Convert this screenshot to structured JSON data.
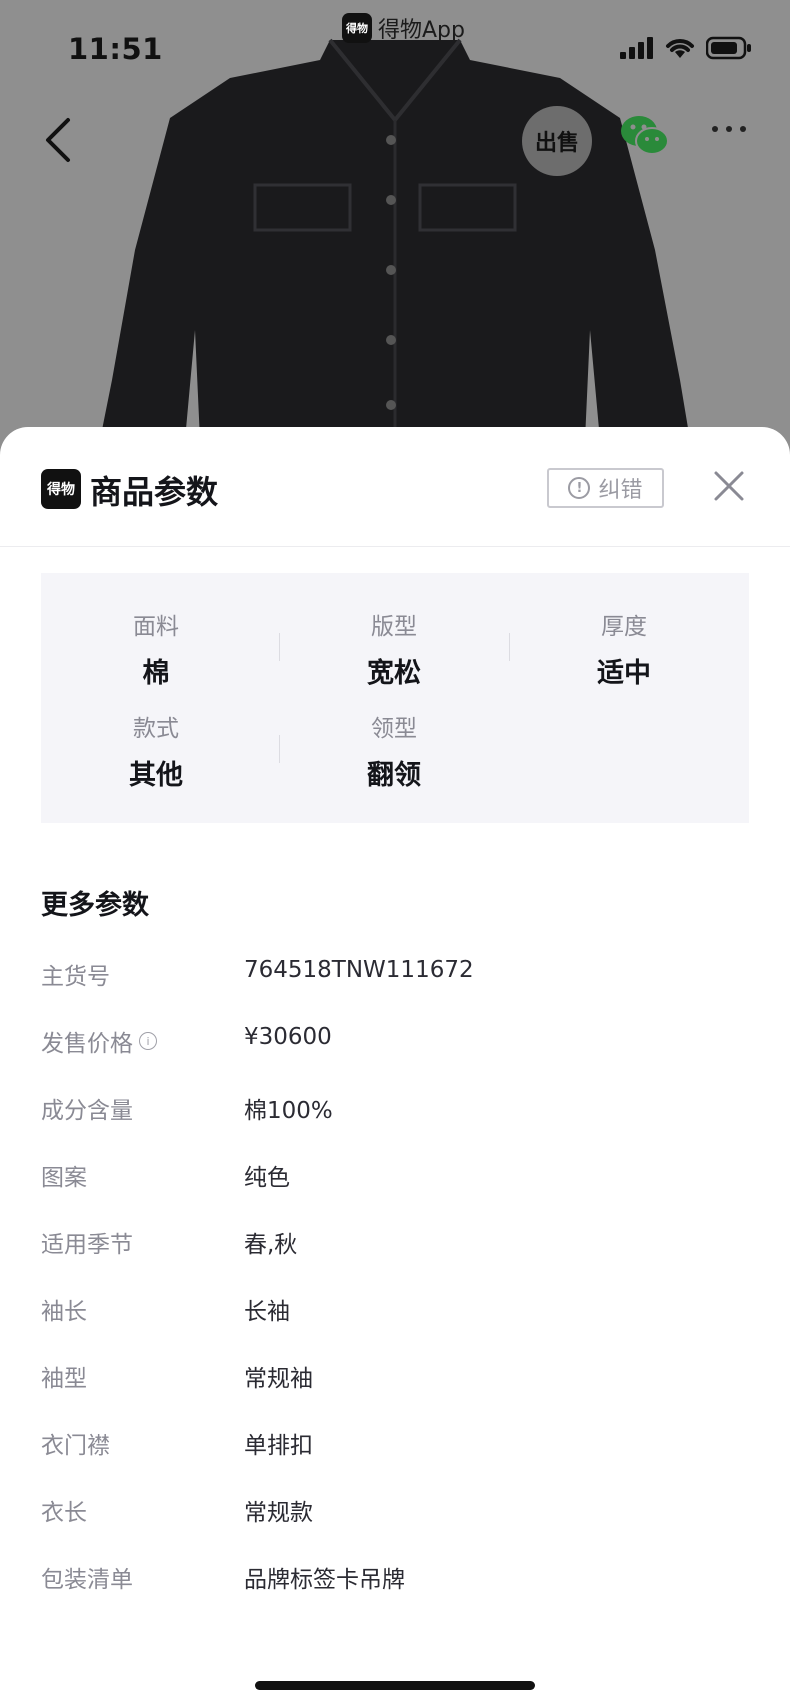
{
  "status_bar": {
    "time": "11:51",
    "app_name": "得物App",
    "app_logo": "得物"
  },
  "top_nav": {
    "sell_label": "出售",
    "back_icon": "chevron-left-icon",
    "share_icon": "wechat-icon",
    "more_icon": "more-dots-icon"
  },
  "sheet": {
    "logo": "得物",
    "title": "商品参数",
    "correct_label": "纠错",
    "close_icon": "close-icon"
  },
  "summary": [
    {
      "label": "面料",
      "value": "棉"
    },
    {
      "label": "版型",
      "value": "宽松"
    },
    {
      "label": "厚度",
      "value": "适中"
    },
    {
      "label": "款式",
      "value": "其他"
    },
    {
      "label": "领型",
      "value": "翻领"
    }
  ],
  "more_params": {
    "title": "更多参数",
    "rows": [
      {
        "key": "主货号",
        "value": "764518TNW111672"
      },
      {
        "key": "发售价格",
        "value": "¥30600"
      },
      {
        "key": "成分含量",
        "value": "棉100%"
      },
      {
        "key": "图案",
        "value": "纯色"
      },
      {
        "key": "适用季节",
        "value": "春,秋"
      },
      {
        "key": "袖长",
        "value": "长袖"
      },
      {
        "key": "袖型",
        "value": "常规袖"
      },
      {
        "key": "衣门襟",
        "value": "单排扣"
      },
      {
        "key": "衣长",
        "value": "常规款"
      },
      {
        "key": "包装清单",
        "value": "品牌标签卡吊牌"
      }
    ]
  }
}
